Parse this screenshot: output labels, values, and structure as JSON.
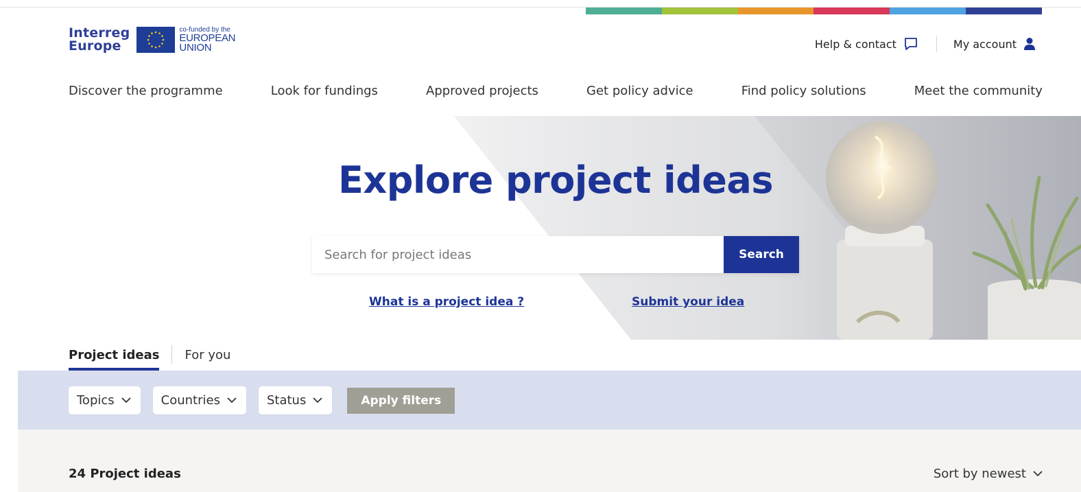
{
  "brand": {
    "logo_line1": "Interreg",
    "logo_line2": "Europe",
    "eu_small": "co-funded by the",
    "eu_line1": "EUROPEAN",
    "eu_line2": "UNION",
    "color_stripes": [
      "#4fae94",
      "#a2c43a",
      "#e8962c",
      "#d8385a",
      "#4ea3e0",
      "#2e3f96"
    ],
    "primary_color": "#1d3496"
  },
  "utility": {
    "help_label": "Help & contact",
    "account_label": "My account"
  },
  "nav": {
    "items": [
      {
        "label": "Discover the programme"
      },
      {
        "label": "Look for fundings"
      },
      {
        "label": "Approved projects"
      },
      {
        "label": "Get policy advice"
      },
      {
        "label": "Find policy solutions"
      },
      {
        "label": "Meet the community"
      }
    ]
  },
  "hero": {
    "title": "Explore project ideas",
    "search_placeholder": "Search for project ideas",
    "search_button": "Search",
    "link_what": "What is a project idea ?",
    "link_submit": "Submit your idea"
  },
  "tabs": [
    {
      "label": "Project ideas",
      "active": true
    },
    {
      "label": "For you",
      "active": false
    }
  ],
  "filters": {
    "topics": "Topics",
    "countries": "Countries",
    "status": "Status",
    "apply": "Apply filters"
  },
  "results": {
    "count_label": "24 Project ideas",
    "sort_label": "Sort by newest"
  }
}
